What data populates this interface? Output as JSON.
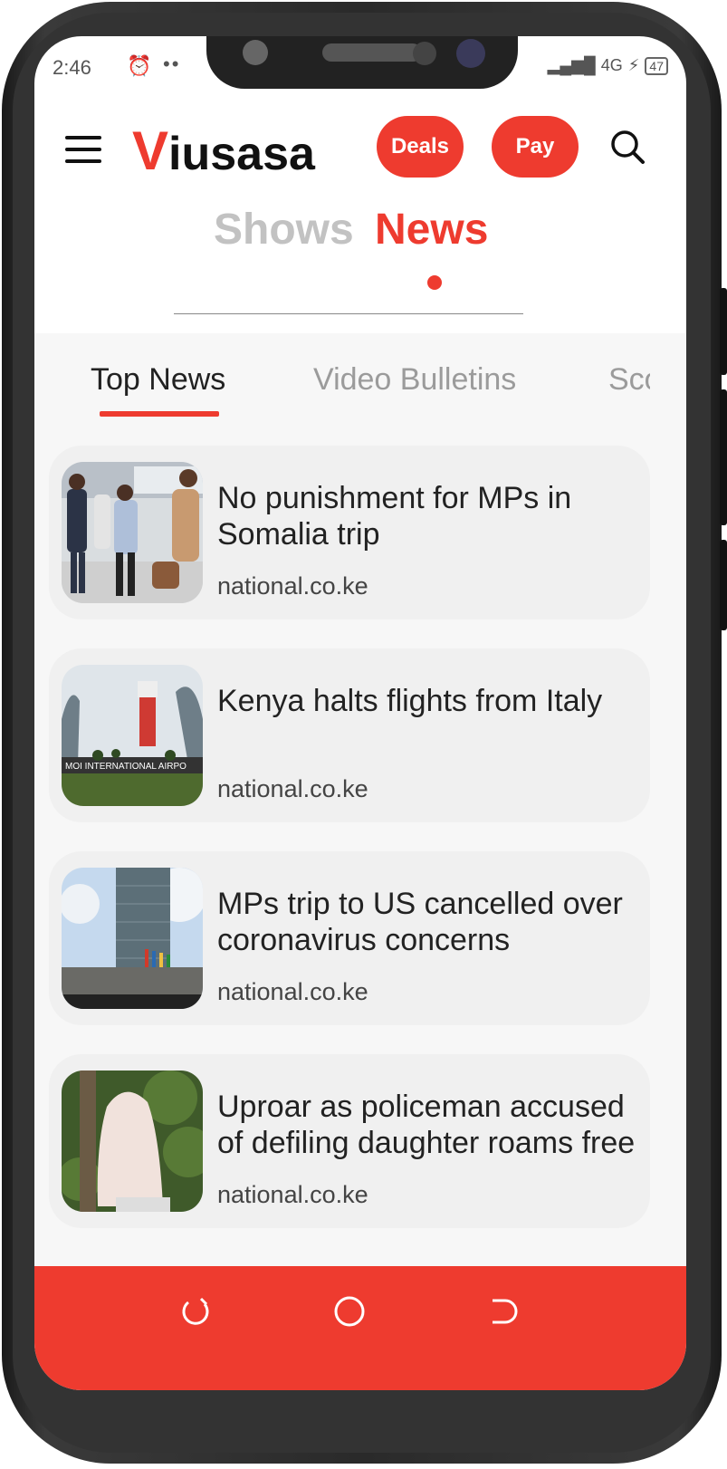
{
  "status_bar": {
    "time": "2:46",
    "network": "4G",
    "battery": "47"
  },
  "header": {
    "logo_first_letter": "V",
    "logo_rest": "iusasa",
    "deals_label": "Deals",
    "pay_label": "Pay"
  },
  "main_tabs": {
    "shows": "Shows",
    "news": "News",
    "active": "News"
  },
  "sub_tabs": {
    "top_news": "Top News",
    "video_bulletins": "Video Bulletins",
    "partial": "Sco",
    "active": "Top News"
  },
  "articles": [
    {
      "title": "No punishment for MPs in Somalia trip",
      "source": "national.co.ke"
    },
    {
      "title": "Kenya halts flights from Italy",
      "source": "national.co.ke"
    },
    {
      "title": "MPs trip to US cancelled over coronavirus concerns",
      "source": "national.co.ke"
    },
    {
      "title": "Uproar as policeman accused of defiling daughter roams free",
      "source": "national.co.ke"
    }
  ],
  "images": {
    "article_1_sign": "MOI INTERNATIONAL AIRPO"
  },
  "colors": {
    "accent": "#ee3b2f",
    "inactive_tab": "#c2c2c2",
    "card_bg": "#f0f0f0"
  }
}
